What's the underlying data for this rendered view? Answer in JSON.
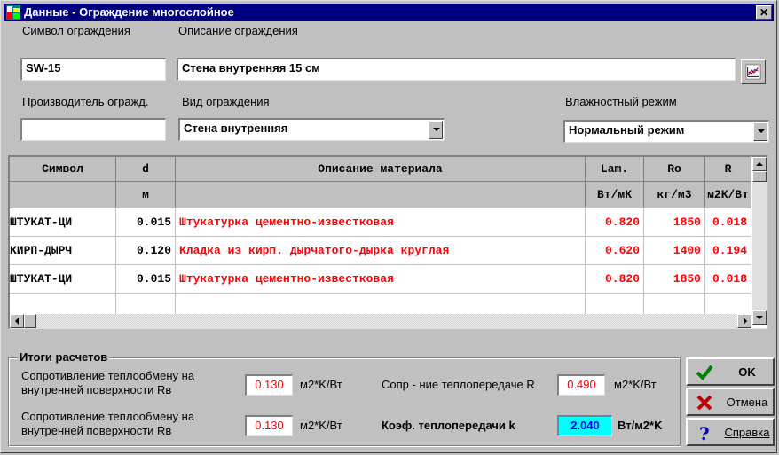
{
  "window": {
    "title": "Данные - Ограждение многослойное",
    "close_glyph": "✕"
  },
  "symbol": {
    "label": "Символ ограждения",
    "value": "SW-15"
  },
  "description": {
    "label": "Описание ограждения",
    "value": "Стена внутренняя 15 см"
  },
  "manufacturer": {
    "label": "Производитель огражд.",
    "value": ""
  },
  "type": {
    "label": "Вид ограждения",
    "value": "Стена внутренняя"
  },
  "humidity": {
    "label": "Влажностный режим",
    "value": "Нормальный режим"
  },
  "table": {
    "headers": [
      "Символ",
      "d",
      "Описание материала",
      "Lam.",
      "Ro",
      "R"
    ],
    "units": [
      "",
      "м",
      "",
      "Вт/мК",
      "кг/м3",
      "м2К/Вт"
    ],
    "rows": [
      [
        "ШТУКАТ-ЦИ",
        "0.015",
        "Штукатурка цементно-известковая",
        "0.820",
        "1850",
        "0.018"
      ],
      [
        "КИРП-ДЫРЧ",
        "0.120",
        "Кладка из кирп. дырчатого-дырка круглая",
        "0.620",
        "1400",
        "0.194"
      ],
      [
        "ШТУКАТ-ЦИ",
        "0.015",
        "Штукатурка цементно-известковая",
        "0.820",
        "1850",
        "0.018"
      ]
    ]
  },
  "results": {
    "title": "Итоги расчетов",
    "r_inner_label": [
      "Сопротивление теплообмену на",
      "внутренней поверхности Rв"
    ],
    "r_inner_value": "0.130",
    "r_inner_unit": "м2*K/Вт",
    "r_inner2_label": [
      "Сопротивление теплообмену на",
      "внутренней поверхности Rв"
    ],
    "r_inner2_value": "0.130",
    "r_inner2_unit": "м2*K/Вт",
    "r_total_label": "Сопр - ние теплопередаче R",
    "r_total_value": "0.490",
    "r_total_unit": "м2*K/Вт",
    "k_label": "Коэф. теплопередачи k",
    "k_value": "2.040",
    "k_unit": "Вт/м2*K"
  },
  "buttons": {
    "ok": "OK",
    "cancel": "Отмена",
    "help": "Справка"
  },
  "colors": {
    "title_bar": "#000080",
    "material_text": "#ff0000",
    "k_highlight": "#00ffff"
  }
}
